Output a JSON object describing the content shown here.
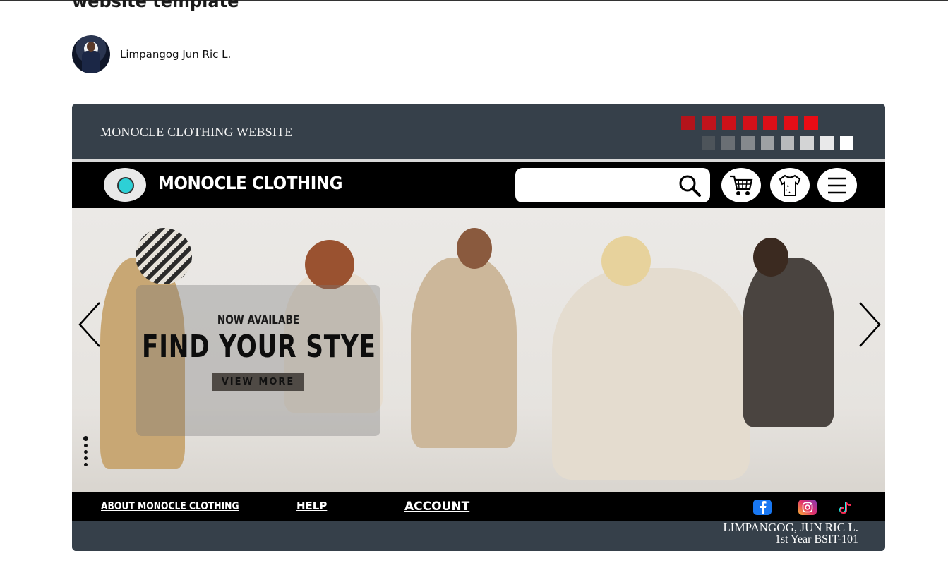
{
  "page": {
    "title": "website template"
  },
  "author": {
    "name": "Limpangog Jun Ric L."
  },
  "site": {
    "caption": "MONOCLE CLOTHING WEBSITE",
    "brand": "MONOCLE CLOTHING",
    "palette": {
      "reds": [
        "#b3141b",
        "#c0141c",
        "#cc1119",
        "#d4111a",
        "#dc0f18",
        "#e30e17",
        "#ea0c15"
      ],
      "grays": [
        "#4d545a",
        "#6a6f74",
        "#85898d",
        "#9ea1a4",
        "#b8babc",
        "#d3d4d5",
        "#e9e9ea",
        "#ffffff"
      ]
    },
    "nav_icons": [
      "search-icon",
      "shopping-cart-icon",
      "shirt-icon",
      "hamburger-menu-icon"
    ]
  },
  "hero": {
    "kicker": "NOW AVAILABE",
    "headline": "FIND YOUR STYE",
    "cta": "VIEW MORE",
    "slide_count": 5,
    "active_slide": 1
  },
  "footer": {
    "links": [
      "ABOUT MONOCLE CLOTHING",
      "HELP",
      "ACCOUNT"
    ],
    "social": [
      "facebook-icon",
      "instagram-icon",
      "tiktok-icon"
    ],
    "credit_name": "LIMPANGOG, JUN RIC L.",
    "credit_year": "1st Year BSIT-101"
  }
}
